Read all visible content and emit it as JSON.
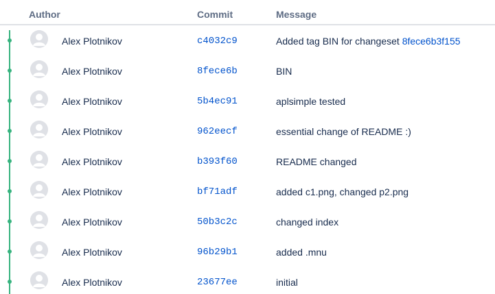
{
  "header": {
    "author": "Author",
    "commit": "Commit",
    "message": "Message"
  },
  "colors": {
    "graph": "#36b37e",
    "link": "#0052cc",
    "header_text": "#5e6c84",
    "text": "#172b4d"
  },
  "commits": [
    {
      "author": "Alex Plotnikov",
      "hash": "c4032c9",
      "message": "Added tag BIN for changeset ",
      "message_link": "8fece6b3f155"
    },
    {
      "author": "Alex Plotnikov",
      "hash": "8fece6b",
      "message": "BIN",
      "message_link": ""
    },
    {
      "author": "Alex Plotnikov",
      "hash": "5b4ec91",
      "message": "aplsimple tested",
      "message_link": ""
    },
    {
      "author": "Alex Plotnikov",
      "hash": "962eecf",
      "message": "essential change of README :)",
      "message_link": ""
    },
    {
      "author": "Alex Plotnikov",
      "hash": "b393f60",
      "message": "README changed",
      "message_link": ""
    },
    {
      "author": "Alex Plotnikov",
      "hash": "bf71adf",
      "message": "added c1.png, changed p2.png",
      "message_link": ""
    },
    {
      "author": "Alex Plotnikov",
      "hash": "50b3c2c",
      "message": "changed index",
      "message_link": ""
    },
    {
      "author": "Alex Plotnikov",
      "hash": "96b29b1",
      "message": "added .mnu",
      "message_link": ""
    },
    {
      "author": "Alex Plotnikov",
      "hash": "23677ee",
      "message": "initial",
      "message_link": ""
    }
  ]
}
